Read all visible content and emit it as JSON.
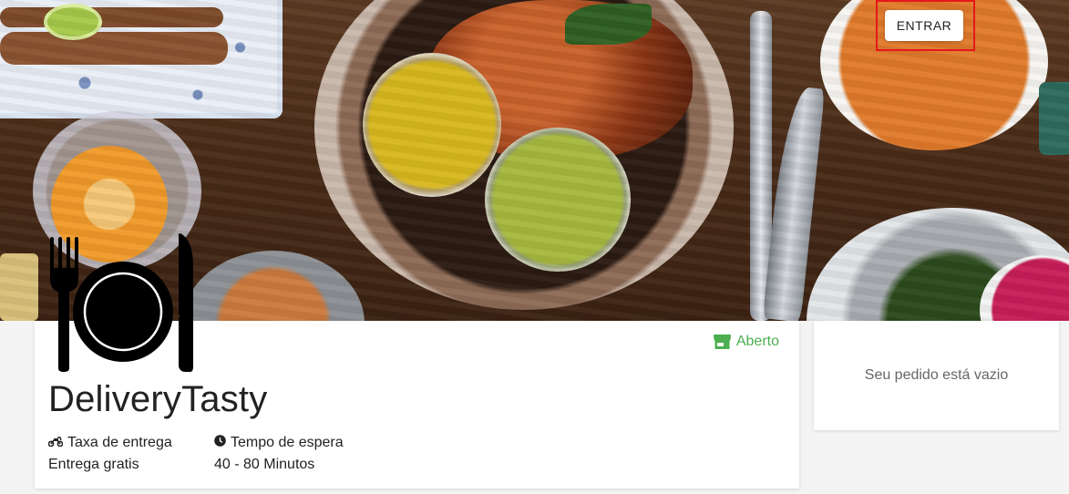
{
  "header": {
    "login_button": "ENTRAR",
    "banner_image": "food-banner-image"
  },
  "restaurant": {
    "logo_icon": "cutlery-plate-icon",
    "name": "DeliveryTasty",
    "status": {
      "icon": "store-icon",
      "label": "Aberto",
      "color": "#4caf50"
    },
    "delivery_fee": {
      "icon": "motorcycle-icon",
      "label": "Taxa de entrega",
      "value": "Entrega gratis"
    },
    "wait_time": {
      "icon": "clock-icon",
      "label": "Tempo de espera",
      "value": "40 - 80 Minutos"
    }
  },
  "order": {
    "empty_message": "Seu pedido está vazio"
  },
  "colors": {
    "highlight_border": "#e8161c",
    "status_green": "#4caf50"
  }
}
